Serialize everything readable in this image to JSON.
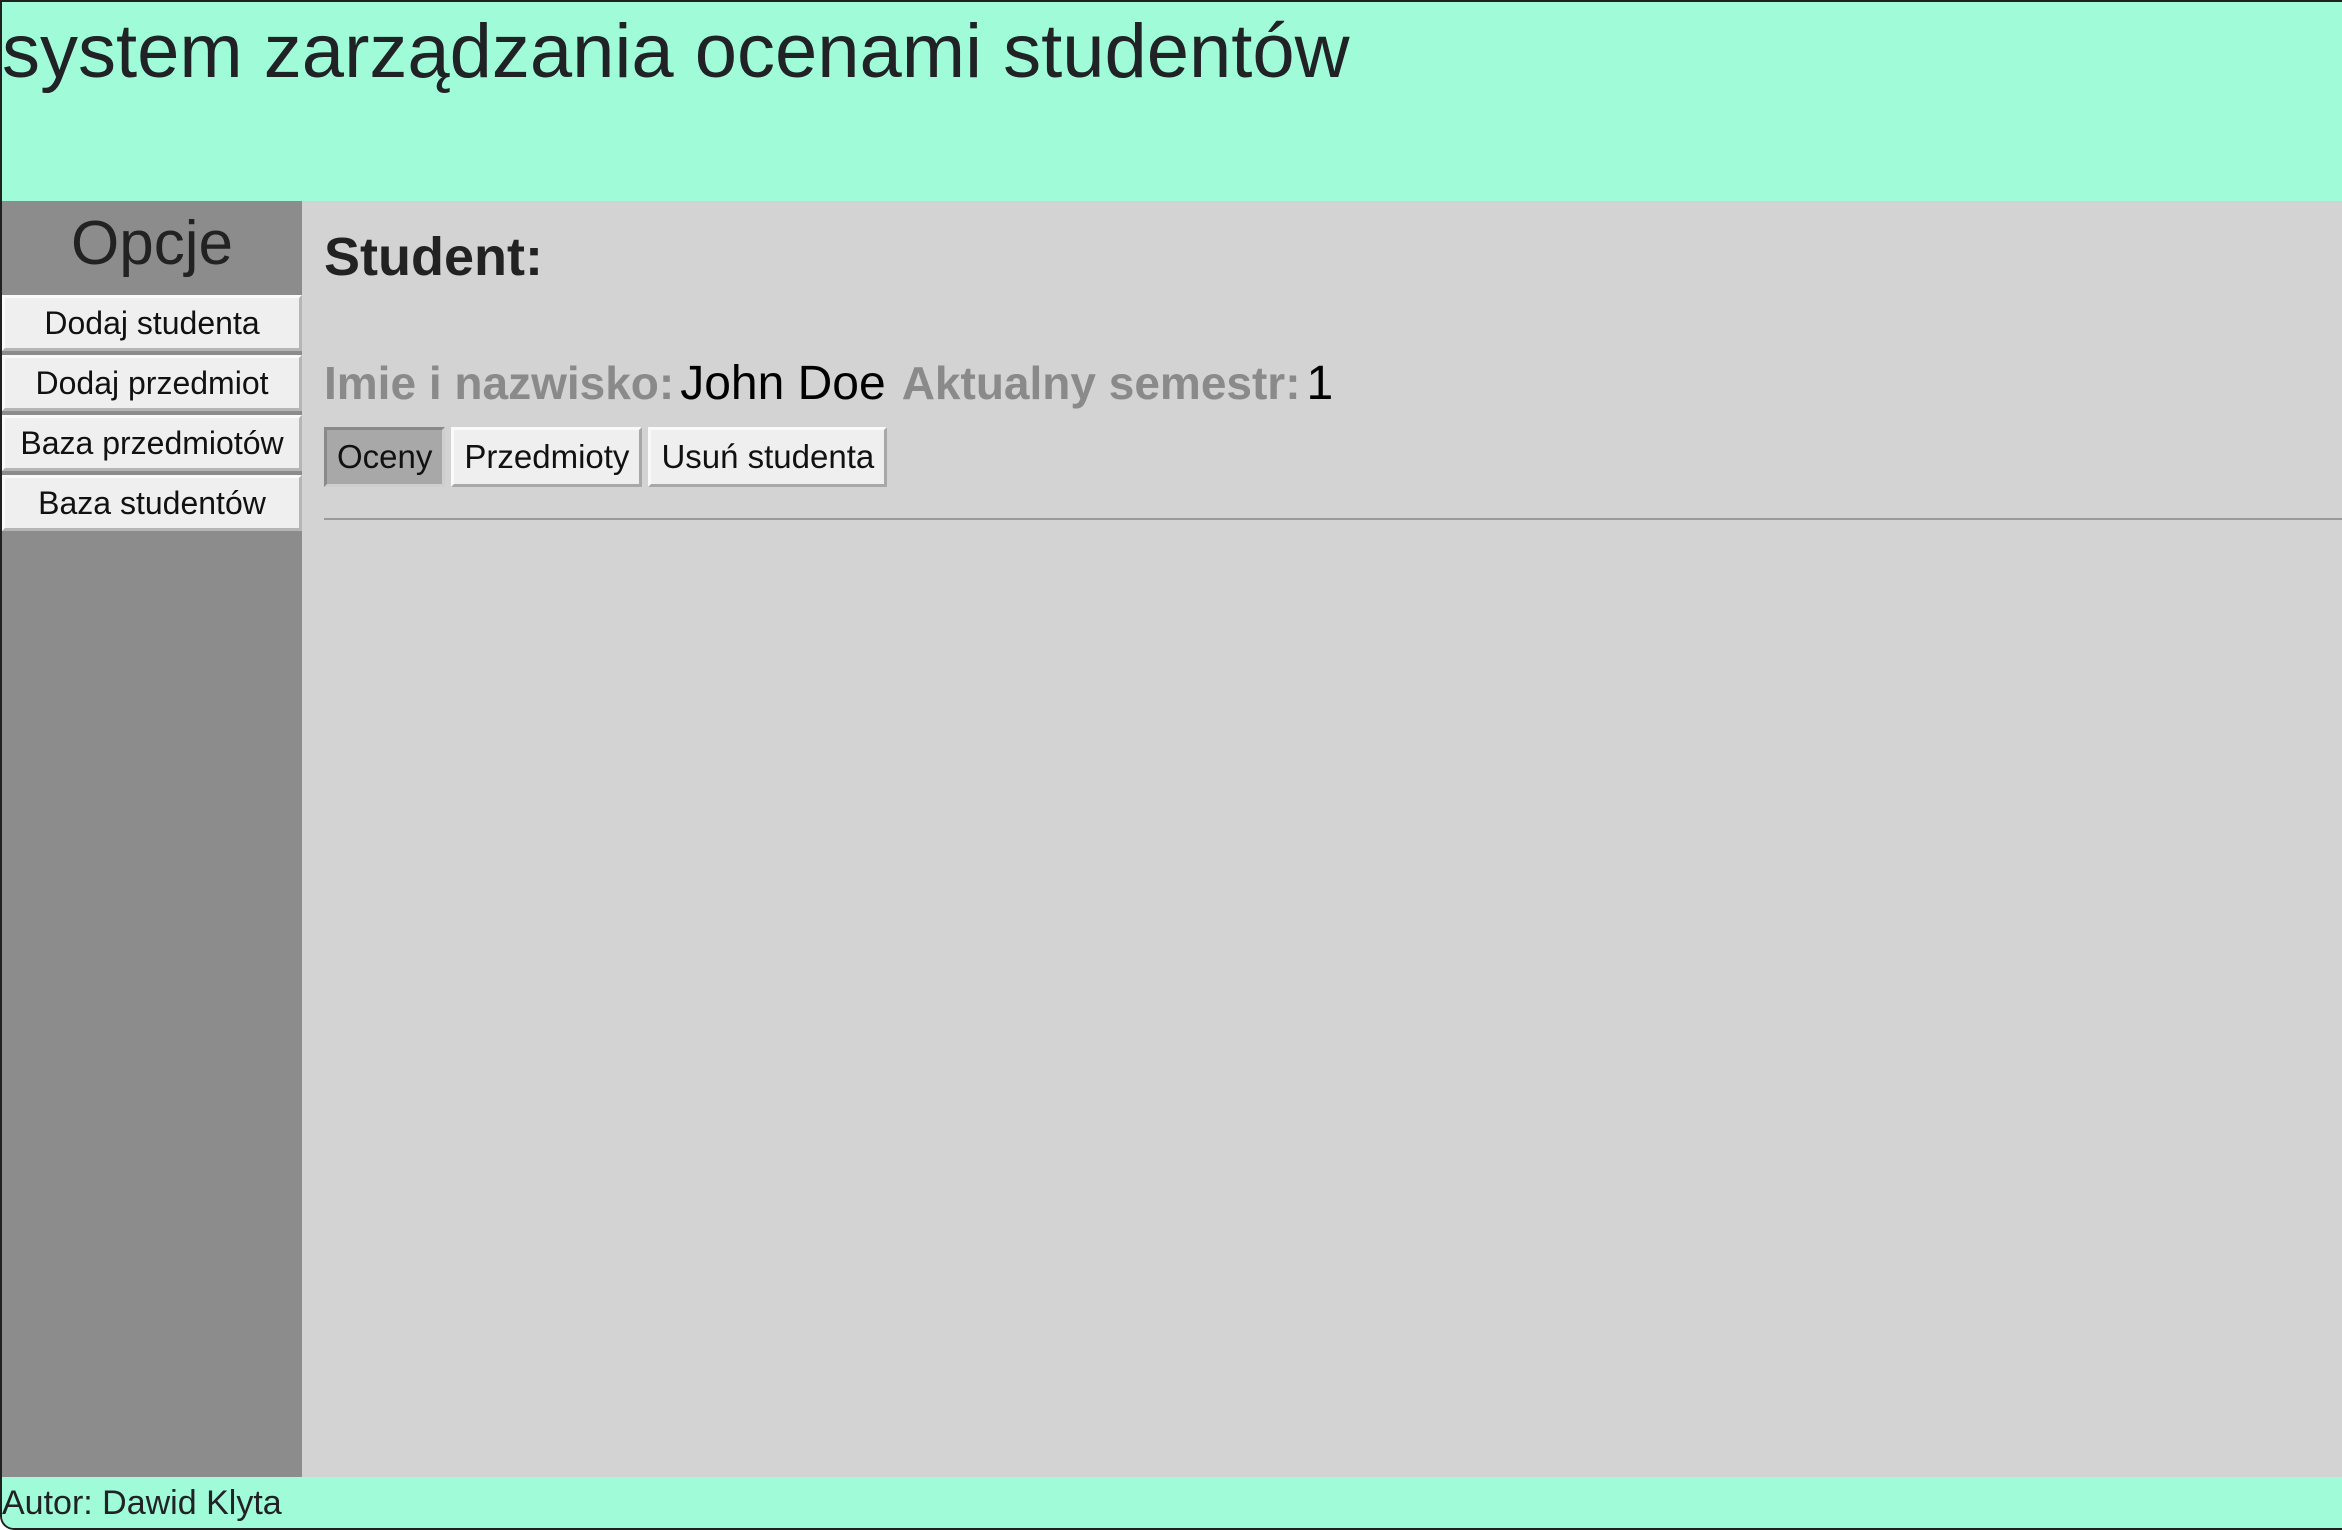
{
  "header": {
    "title": "system zarządzania ocenami studentów"
  },
  "sidebar": {
    "title": "Opcje",
    "items": [
      {
        "label": "Dodaj studenta"
      },
      {
        "label": "Dodaj przedmiot"
      },
      {
        "label": "Baza przedmiotów"
      },
      {
        "label": "Baza studentów"
      }
    ]
  },
  "main": {
    "heading": "Student:",
    "name_label": "Imie i nazwisko:",
    "name_value": "John Doe",
    "semester_label": "Aktualny semestr:",
    "semester_value": "1",
    "tabs": [
      {
        "label": "Oceny",
        "active": true
      },
      {
        "label": "Przedmioty",
        "active": false
      },
      {
        "label": "Usuń studenta",
        "active": false
      }
    ]
  },
  "footer": {
    "author": "Autor: Dawid Klyta"
  },
  "colors": {
    "header_bg": "#a0fcd8",
    "sidebar_bg": "#8c8c8c",
    "main_bg": "#d3d3d3",
    "label_gray": "#8a8a8a"
  }
}
